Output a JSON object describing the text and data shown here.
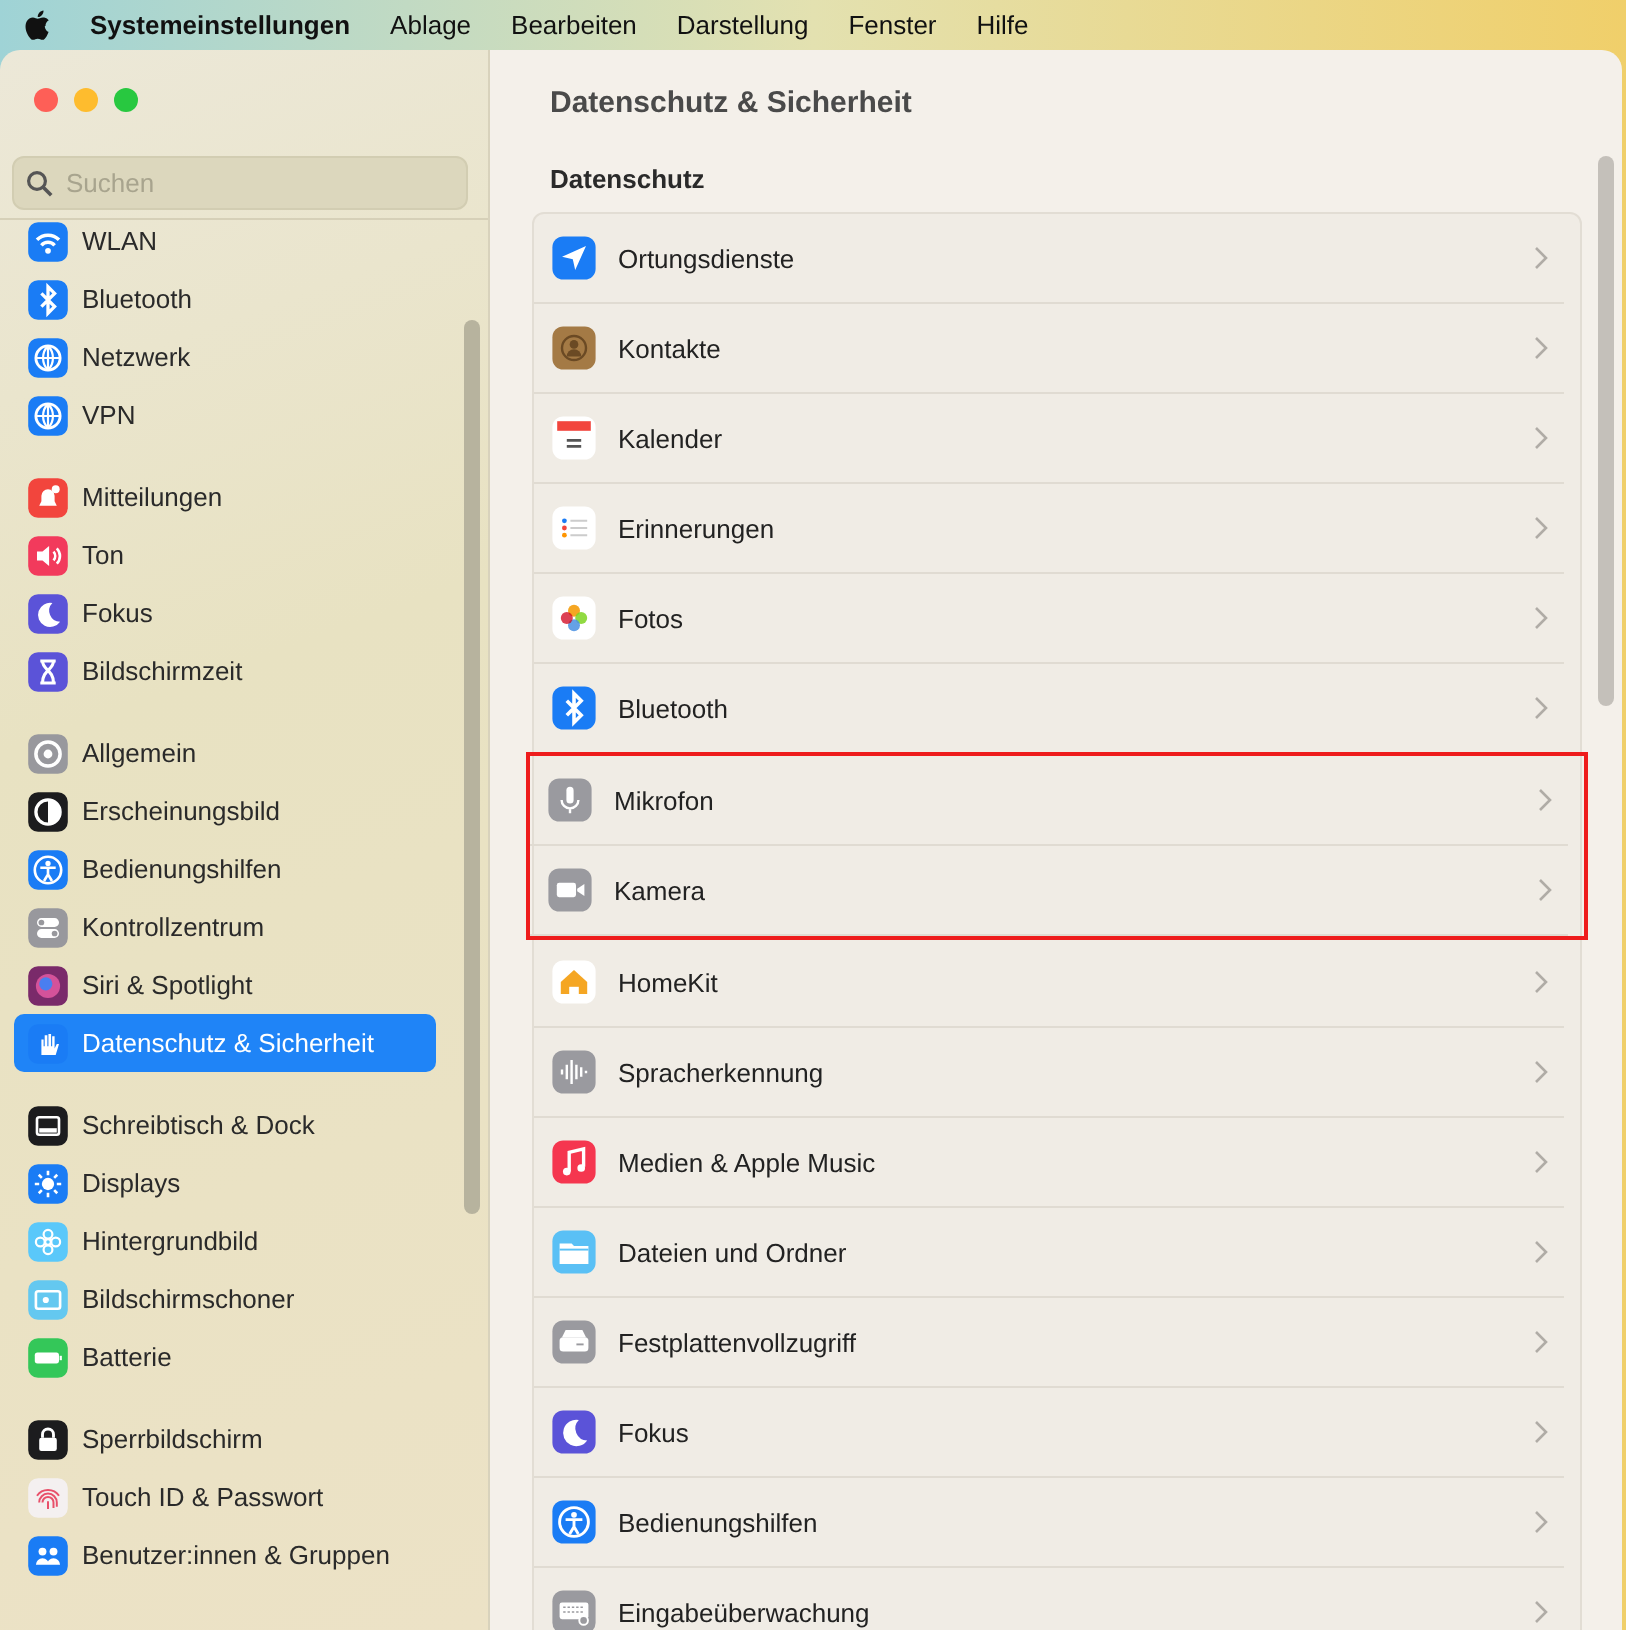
{
  "menu_bar": {
    "app_name": "Systemeinstellungen",
    "menus": [
      "Ablage",
      "Bearbeiten",
      "Darstellung",
      "Fenster",
      "Hilfe"
    ]
  },
  "sidebar": {
    "search": {
      "placeholder": "Suchen"
    },
    "groups": [
      [
        {
          "label": "WLAN",
          "color": "#1a7cf5",
          "selected": false
        },
        {
          "label": "Bluetooth",
          "color": "#1a7cf5",
          "selected": false
        },
        {
          "label": "Netzwerk",
          "color": "#1a7cf5",
          "selected": false
        },
        {
          "label": "VPN",
          "color": "#1a7cf5",
          "selected": false
        }
      ],
      [
        {
          "label": "Mitteilungen",
          "color": "#f2453d",
          "selected": false
        },
        {
          "label": "Ton",
          "color": "#f23a5c",
          "selected": false
        },
        {
          "label": "Fokus",
          "color": "#5b53d8",
          "selected": false
        },
        {
          "label": "Bildschirmzeit",
          "color": "#5b53d8",
          "selected": false
        }
      ],
      [
        {
          "label": "Allgemein",
          "color": "#98989d",
          "selected": false
        },
        {
          "label": "Erscheinungsbild",
          "color": "#1c1c1e",
          "selected": false
        },
        {
          "label": "Bedienungshilfen",
          "color": "#1a7cf5",
          "selected": false
        },
        {
          "label": "Kontrollzentrum",
          "color": "#98989d",
          "selected": false
        },
        {
          "label": "Siri & Spotlight",
          "color": "#7a2a6a",
          "selected": false
        },
        {
          "label": "Datenschutz & Sicherheit",
          "color": "#1a7cf5",
          "selected": true
        }
      ],
      [
        {
          "label": "Schreibtisch & Dock",
          "color": "#1c1c1e",
          "selected": false
        },
        {
          "label": "Displays",
          "color": "#1a7cf5",
          "selected": false
        },
        {
          "label": "Hintergrundbild",
          "color": "#5ac8fa",
          "selected": false
        },
        {
          "label": "Bildschirmschoner",
          "color": "#64c8f0",
          "selected": false
        },
        {
          "label": "Batterie",
          "color": "#34c759",
          "selected": false
        }
      ],
      [
        {
          "label": "Sperrbildschirm",
          "color": "#1c1c1e",
          "selected": false
        },
        {
          "label": "Touch ID & Passwort",
          "color": "#f4f0f0",
          "selected": false
        },
        {
          "label": "Benutzer:innen & Gruppen",
          "color": "#1a7cf5",
          "selected": false
        }
      ]
    ]
  },
  "content": {
    "title": "Datenschutz & Sicherheit",
    "section": "Datenschutz",
    "rows": [
      {
        "label": "Ortungsdienste",
        "color": "#1a7cf5",
        "highlighted": false
      },
      {
        "label": "Kontakte",
        "color": "#a47a45",
        "highlighted": false
      },
      {
        "label": "Kalender",
        "color": "#ffffff",
        "highlighted": false
      },
      {
        "label": "Erinnerungen",
        "color": "#ffffff",
        "highlighted": false
      },
      {
        "label": "Fotos",
        "color": "#ffffff",
        "highlighted": false
      },
      {
        "label": "Bluetooth",
        "color": "#1a7cf5",
        "highlighted": false
      },
      {
        "label": "Mikrofon",
        "color": "#9a9a9f",
        "highlighted": true
      },
      {
        "label": "Kamera",
        "color": "#9a9a9f",
        "highlighted": true
      },
      {
        "label": "HomeKit",
        "color": "#ffffff",
        "highlighted": false
      },
      {
        "label": "Spracherkennung",
        "color": "#9a9a9f",
        "highlighted": false
      },
      {
        "label": "Medien & Apple Music",
        "color": "#f5364f",
        "highlighted": false
      },
      {
        "label": "Dateien und Ordner",
        "color": "#5ac0f5",
        "highlighted": false
      },
      {
        "label": "Festplattenvollzugriff",
        "color": "#9a9a9f",
        "highlighted": false
      },
      {
        "label": "Fokus",
        "color": "#5b53d8",
        "highlighted": false
      },
      {
        "label": "Bedienungshilfen",
        "color": "#1a7cf5",
        "highlighted": false
      },
      {
        "label": "Eingabeüberwachung",
        "color": "#9a9a9f",
        "highlighted": false
      }
    ]
  }
}
